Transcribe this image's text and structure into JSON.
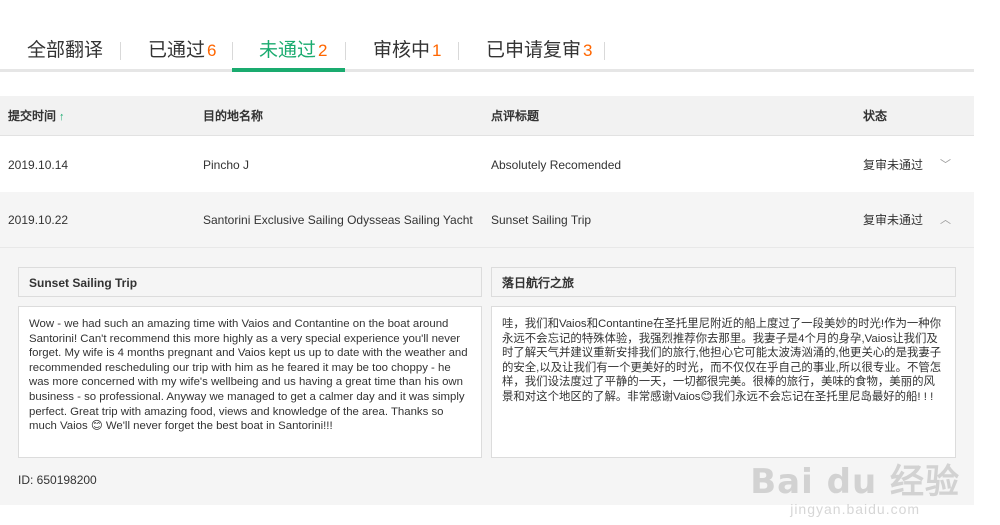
{
  "tabs": [
    {
      "label": "全部翻译",
      "count": ""
    },
    {
      "label": "已通过",
      "count": "6"
    },
    {
      "label": "未通过",
      "count": "2"
    },
    {
      "label": "审核中",
      "count": "1"
    },
    {
      "label": "已申请复审",
      "count": "3"
    }
  ],
  "table": {
    "headers": {
      "time": "提交时间",
      "sort_arrow": "↑",
      "destination": "目的地名称",
      "title": "点评标题",
      "status": "状态"
    },
    "rows": [
      {
        "time": "2019.10.14",
        "destination": "Pincho J",
        "title": "Absolutely Recomended",
        "status": "复审未通过",
        "chevron": "﹀"
      },
      {
        "time": "2019.10.22",
        "destination": "Santorini Exclusive Sailing Odysseas Sailing Yacht",
        "title": "Sunset Sailing Trip",
        "status": "复审未通过",
        "chevron": "︿"
      }
    ]
  },
  "detail": {
    "original_title": "Sunset Sailing Trip",
    "original_text": "Wow - we had such an amazing time with Vaios and Contantine on the boat around Santorini! Can't recommend this more highly as a very special experience you'll never forget. My wife is 4 months pregnant and Vaios kept us up to date with the weather and recommended rescheduling our trip with him as he feared it may be too choppy - he was more concerned with my wife's wellbeing and us having a great time than his own business - so professional. Anyway we managed to get a calmer day and it was simply perfect. Great trip with amazing food, views and knowledge of the area. Thanks so much Vaios 😊 We'll never forget the best boat in Santorini!!!",
    "translated_title": "落日航行之旅",
    "translated_text": "哇，我们和Vaios和Contantine在圣托里尼附近的船上度过了一段美妙的时光!作为一种你永远不会忘记的特殊体验，我强烈推荐你去那里。我妻子是4个月的身孕,Vaios让我们及时了解天气并建议重新安排我们的旅行,他担心它可能太波涛汹涌的,他更关心的是我妻子的安全,以及让我们有一个更美好的时光，而不仅仅在乎自己的事业,所以很专业。不管怎样，我们设法度过了平静的一天，一切都很完美。很棒的旅行，美味的食物，美丽的风景和对这个地区的了解。非常感谢Vaios😊我们永远不会忘记在圣托里尼岛最好的船! ! !",
    "id_line": "ID: 650198200"
  },
  "watermark": {
    "logo": "Bai du 经验",
    "url": "jingyan.baidu.com"
  }
}
